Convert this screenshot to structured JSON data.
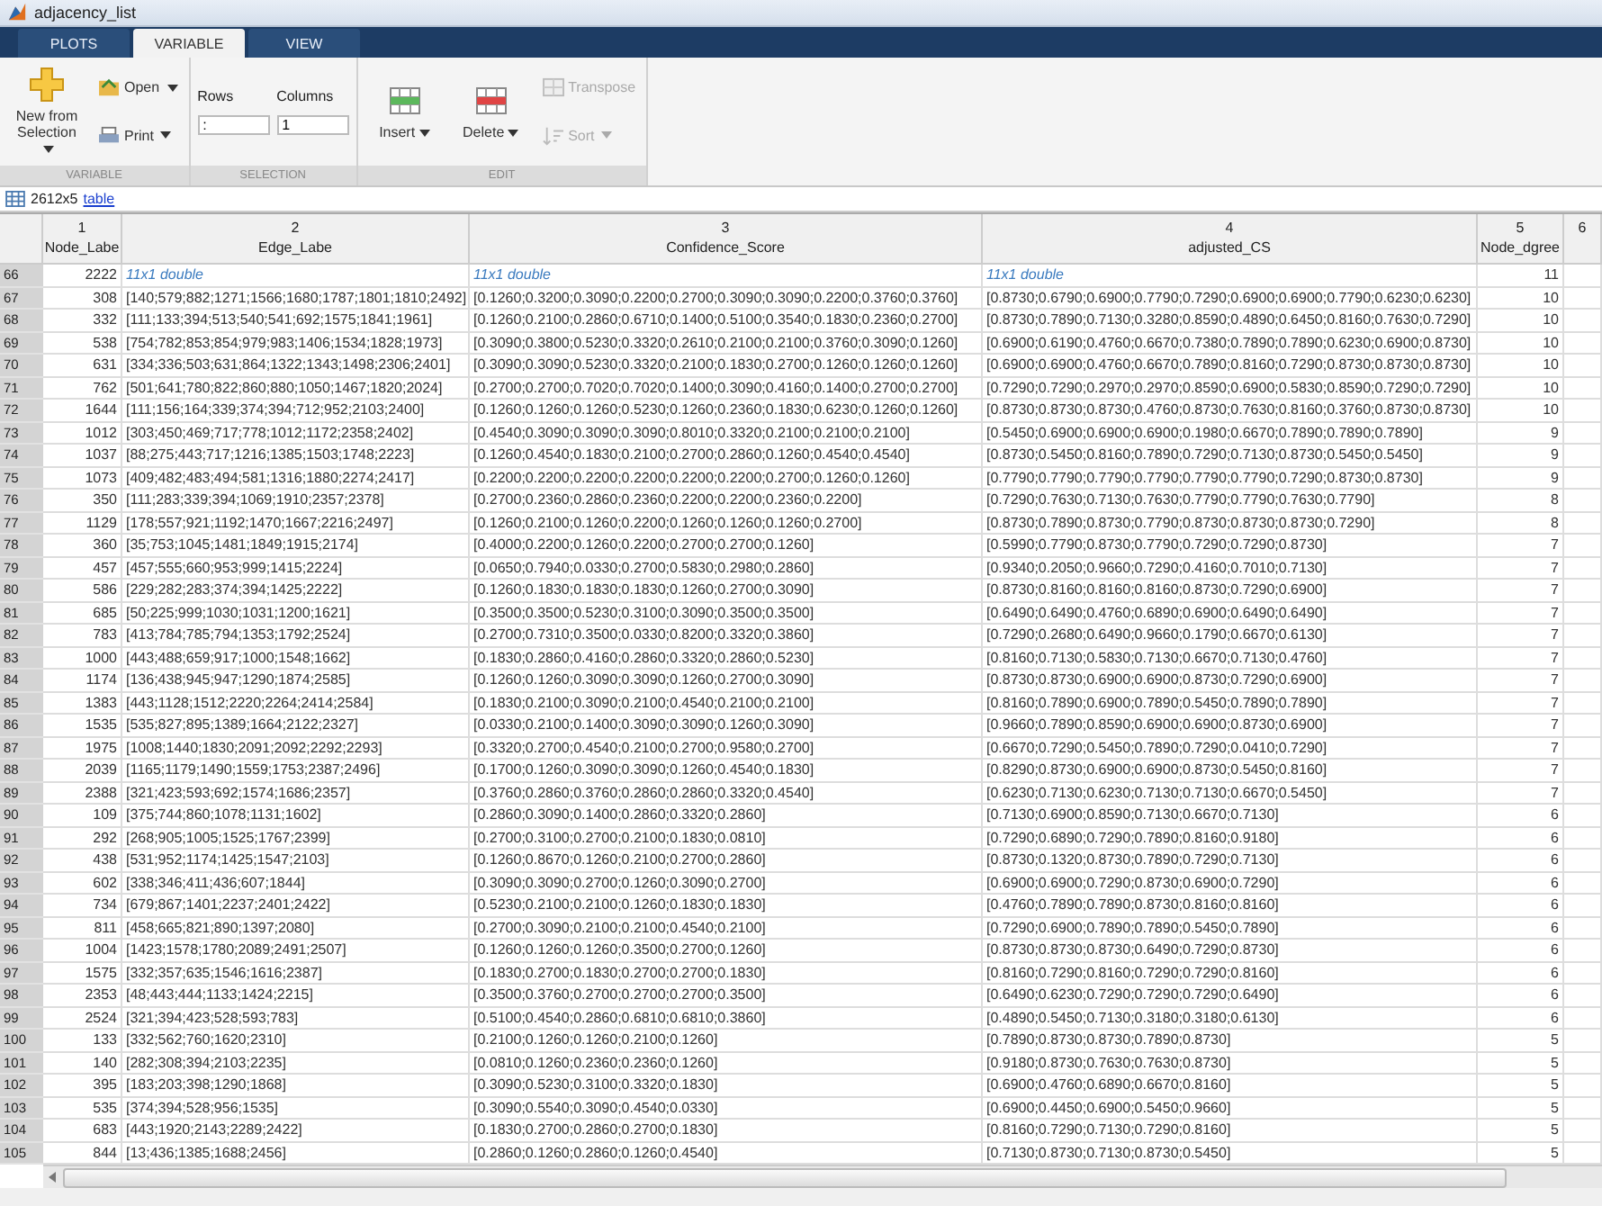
{
  "window": {
    "title": "adjacency_list"
  },
  "tabs": [
    {
      "label": "PLOTS",
      "selected": false
    },
    {
      "label": "VARIABLE",
      "selected": true
    },
    {
      "label": "VIEW",
      "selected": false
    }
  ],
  "ribbon": [
    {
      "label": "VARIABLE",
      "items": [
        {
          "kind": "large",
          "label": "New from Selection",
          "dropdown": true,
          "disabled": false
        },
        {
          "kind": "small",
          "label": "Open",
          "dropdown": true,
          "disabled": false
        },
        {
          "kind": "small",
          "label": "Print",
          "dropdown": true,
          "disabled": false
        }
      ]
    },
    {
      "label": "SELECTION",
      "items": [
        {
          "kind": "field",
          "label": "Rows",
          "value": ":"
        },
        {
          "kind": "field",
          "label": "Columns",
          "value": "1"
        }
      ]
    },
    {
      "label": "EDIT",
      "items": [
        {
          "kind": "large",
          "label": "Insert",
          "dropdown": true,
          "disabled": false
        },
        {
          "kind": "large",
          "label": "Delete",
          "dropdown": true,
          "disabled": false
        },
        {
          "kind": "small",
          "label": "Transpose",
          "dropdown": false,
          "disabled": true
        },
        {
          "kind": "small",
          "label": "Sort",
          "dropdown": true,
          "disabled": true
        }
      ]
    }
  ],
  "variable_info": {
    "size": "2612x5",
    "type_link": "table"
  },
  "table": {
    "columns": [
      {
        "index": "1",
        "name": "Node_Labe"
      },
      {
        "index": "2",
        "name": "Edge_Labe"
      },
      {
        "index": "3",
        "name": "Confidence_Score"
      },
      {
        "index": "4",
        "name": "adjusted_CS"
      },
      {
        "index": "5",
        "name": "Node_dgree"
      },
      {
        "index": "6"
      }
    ],
    "rows": [
      {
        "row": "66",
        "summary": true,
        "node_labe": "2222",
        "edge_labe": "11x1 double",
        "confidence_score": "11x1 double",
        "adjusted_cs": "11x1 double",
        "node_dgree": "11"
      },
      {
        "row": "67",
        "summary": false,
        "node_labe": "308",
        "edge_labe": "[140;579;882;1271;1566;1680;1787;1801;1810;2492]",
        "confidence_score": "[0.1260;0.3200;0.3090;0.2200;0.2700;0.3090;0.3090;0.2200;0.3760;0.3760]",
        "adjusted_cs": "[0.8730;0.6790;0.6900;0.7790;0.7290;0.6900;0.6900;0.7790;0.6230;0.6230]",
        "node_dgree": "10"
      },
      {
        "row": "68",
        "summary": false,
        "node_labe": "332",
        "edge_labe": "[111;133;394;513;540;541;692;1575;1841;1961]",
        "confidence_score": "[0.1260;0.2100;0.2860;0.6710;0.1400;0.5100;0.3540;0.1830;0.2360;0.2700]",
        "adjusted_cs": "[0.8730;0.7890;0.7130;0.3280;0.8590;0.4890;0.6450;0.8160;0.7630;0.7290]",
        "node_dgree": "10"
      },
      {
        "row": "69",
        "summary": false,
        "node_labe": "538",
        "edge_labe": "[754;782;853;854;979;983;1406;1534;1828;1973]",
        "confidence_score": "[0.3090;0.3800;0.5230;0.3320;0.2610;0.2100;0.2100;0.3760;0.3090;0.1260]",
        "adjusted_cs": "[0.6900;0.6190;0.4760;0.6670;0.7380;0.7890;0.7890;0.6230;0.6900;0.8730]",
        "node_dgree": "10"
      },
      {
        "row": "70",
        "summary": false,
        "node_labe": "631",
        "edge_labe": "[334;336;503;631;864;1322;1343;1498;2306;2401]",
        "confidence_score": "[0.3090;0.3090;0.5230;0.3320;0.2100;0.1830;0.2700;0.1260;0.1260;0.1260]",
        "adjusted_cs": "[0.6900;0.6900;0.4760;0.6670;0.7890;0.8160;0.7290;0.8730;0.8730;0.8730]",
        "node_dgree": "10"
      },
      {
        "row": "71",
        "summary": false,
        "node_labe": "762",
        "edge_labe": "[501;641;780;822;860;880;1050;1467;1820;2024]",
        "confidence_score": "[0.2700;0.2700;0.7020;0.7020;0.1400;0.3090;0.4160;0.1400;0.2700;0.2700]",
        "adjusted_cs": "[0.7290;0.7290;0.2970;0.2970;0.8590;0.6900;0.5830;0.8590;0.7290;0.7290]",
        "node_dgree": "10"
      },
      {
        "row": "72",
        "summary": false,
        "node_labe": "1644",
        "edge_labe": "[111;156;164;339;374;394;712;952;2103;2400]",
        "confidence_score": "[0.1260;0.1260;0.1260;0.5230;0.1260;0.2360;0.1830;0.6230;0.1260;0.1260]",
        "adjusted_cs": "[0.8730;0.8730;0.8730;0.4760;0.8730;0.7630;0.8160;0.3760;0.8730;0.8730]",
        "node_dgree": "10"
      },
      {
        "row": "73",
        "summary": false,
        "node_labe": "1012",
        "edge_labe": "[303;450;469;717;778;1012;1172;2358;2402]",
        "confidence_score": "[0.4540;0.3090;0.3090;0.3090;0.8010;0.3320;0.2100;0.2100;0.2100]",
        "adjusted_cs": "[0.5450;0.6900;0.6900;0.6900;0.1980;0.6670;0.7890;0.7890;0.7890]",
        "node_dgree": "9"
      },
      {
        "row": "74",
        "summary": false,
        "node_labe": "1037",
        "edge_labe": "[88;275;443;717;1216;1385;1503;1748;2223]",
        "confidence_score": "[0.1260;0.4540;0.1830;0.2100;0.2700;0.2860;0.1260;0.4540;0.4540]",
        "adjusted_cs": "[0.8730;0.5450;0.8160;0.7890;0.7290;0.7130;0.8730;0.5450;0.5450]",
        "node_dgree": "9"
      },
      {
        "row": "75",
        "summary": false,
        "node_labe": "1073",
        "edge_labe": "[409;482;483;494;581;1316;1880;2274;2417]",
        "confidence_score": "[0.2200;0.2200;0.2200;0.2200;0.2200;0.2200;0.2700;0.1260;0.1260]",
        "adjusted_cs": "[0.7790;0.7790;0.7790;0.7790;0.7790;0.7790;0.7290;0.8730;0.8730]",
        "node_dgree": "9"
      },
      {
        "row": "76",
        "summary": false,
        "node_labe": "350",
        "edge_labe": "[111;283;339;394;1069;1910;2357;2378]",
        "confidence_score": "[0.2700;0.2360;0.2860;0.2360;0.2200;0.2200;0.2360;0.2200]",
        "adjusted_cs": "[0.7290;0.7630;0.7130;0.7630;0.7790;0.7790;0.7630;0.7790]",
        "node_dgree": "8"
      },
      {
        "row": "77",
        "summary": false,
        "node_labe": "1129",
        "edge_labe": "[178;557;921;1192;1470;1667;2216;2497]",
        "confidence_score": "[0.1260;0.2100;0.1260;0.2200;0.1260;0.1260;0.1260;0.2700]",
        "adjusted_cs": "[0.8730;0.7890;0.8730;0.7790;0.8730;0.8730;0.8730;0.7290]",
        "node_dgree": "8"
      },
      {
        "row": "78",
        "summary": false,
        "node_labe": "360",
        "edge_labe": "[35;753;1045;1481;1849;1915;2174]",
        "confidence_score": "[0.4000;0.2200;0.1260;0.2200;0.2700;0.2700;0.1260]",
        "adjusted_cs": "[0.5990;0.7790;0.8730;0.7790;0.7290;0.7290;0.8730]",
        "node_dgree": "7"
      },
      {
        "row": "79",
        "summary": false,
        "node_labe": "457",
        "edge_labe": "[457;555;660;953;999;1415;2224]",
        "confidence_score": "[0.0650;0.7940;0.0330;0.2700;0.5830;0.2980;0.2860]",
        "adjusted_cs": "[0.9340;0.2050;0.9660;0.7290;0.4160;0.7010;0.7130]",
        "node_dgree": "7"
      },
      {
        "row": "80",
        "summary": false,
        "node_labe": "586",
        "edge_labe": "[229;282;283;374;394;1425;2222]",
        "confidence_score": "[0.1260;0.1830;0.1830;0.1830;0.1260;0.2700;0.3090]",
        "adjusted_cs": "[0.8730;0.8160;0.8160;0.8160;0.8730;0.7290;0.6900]",
        "node_dgree": "7"
      },
      {
        "row": "81",
        "summary": false,
        "node_labe": "685",
        "edge_labe": "[50;225;999;1030;1031;1200;1621]",
        "confidence_score": "[0.3500;0.3500;0.5230;0.3100;0.3090;0.3500;0.3500]",
        "adjusted_cs": "[0.6490;0.6490;0.4760;0.6890;0.6900;0.6490;0.6490]",
        "node_dgree": "7"
      },
      {
        "row": "82",
        "summary": false,
        "node_labe": "783",
        "edge_labe": "[413;784;785;794;1353;1792;2524]",
        "confidence_score": "[0.2700;0.7310;0.3500;0.0330;0.8200;0.3320;0.3860]",
        "adjusted_cs": "[0.7290;0.2680;0.6490;0.9660;0.1790;0.6670;0.6130]",
        "node_dgree": "7"
      },
      {
        "row": "83",
        "summary": false,
        "node_labe": "1000",
        "edge_labe": "[443;488;659;917;1000;1548;1662]",
        "confidence_score": "[0.1830;0.2860;0.4160;0.2860;0.3320;0.2860;0.5230]",
        "adjusted_cs": "[0.8160;0.7130;0.5830;0.7130;0.6670;0.7130;0.4760]",
        "node_dgree": "7"
      },
      {
        "row": "84",
        "summary": false,
        "node_labe": "1174",
        "edge_labe": "[136;438;945;947;1290;1874;2585]",
        "confidence_score": "[0.1260;0.1260;0.3090;0.3090;0.1260;0.2700;0.3090]",
        "adjusted_cs": "[0.8730;0.8730;0.6900;0.6900;0.8730;0.7290;0.6900]",
        "node_dgree": "7"
      },
      {
        "row": "85",
        "summary": false,
        "node_labe": "1383",
        "edge_labe": "[443;1128;1512;2220;2264;2414;2584]",
        "confidence_score": "[0.1830;0.2100;0.3090;0.2100;0.4540;0.2100;0.2100]",
        "adjusted_cs": "[0.8160;0.7890;0.6900;0.7890;0.5450;0.7890;0.7890]",
        "node_dgree": "7"
      },
      {
        "row": "86",
        "summary": false,
        "node_labe": "1535",
        "edge_labe": "[535;827;895;1389;1664;2122;2327]",
        "confidence_score": "[0.0330;0.2100;0.1400;0.3090;0.3090;0.1260;0.3090]",
        "adjusted_cs": "[0.9660;0.7890;0.8590;0.6900;0.6900;0.8730;0.6900]",
        "node_dgree": "7"
      },
      {
        "row": "87",
        "summary": false,
        "node_labe": "1975",
        "edge_labe": "[1008;1440;1830;2091;2092;2292;2293]",
        "confidence_score": "[0.3320;0.2700;0.4540;0.2100;0.2700;0.9580;0.2700]",
        "adjusted_cs": "[0.6670;0.7290;0.5450;0.7890;0.7290;0.0410;0.7290]",
        "node_dgree": "7"
      },
      {
        "row": "88",
        "summary": false,
        "node_labe": "2039",
        "edge_labe": "[1165;1179;1490;1559;1753;2387;2496]",
        "confidence_score": "[0.1700;0.1260;0.3090;0.3090;0.1260;0.4540;0.1830]",
        "adjusted_cs": "[0.8290;0.8730;0.6900;0.6900;0.8730;0.5450;0.8160]",
        "node_dgree": "7"
      },
      {
        "row": "89",
        "summary": false,
        "node_labe": "2388",
        "edge_labe": "[321;423;593;692;1574;1686;2357]",
        "confidence_score": "[0.3760;0.2860;0.3760;0.2860;0.2860;0.3320;0.4540]",
        "adjusted_cs": "[0.6230;0.7130;0.6230;0.7130;0.7130;0.6670;0.5450]",
        "node_dgree": "7"
      },
      {
        "row": "90",
        "summary": false,
        "node_labe": "109",
        "edge_labe": "[375;744;860;1078;1131;1602]",
        "confidence_score": "[0.2860;0.3090;0.1400;0.2860;0.3320;0.2860]",
        "adjusted_cs": "[0.7130;0.6900;0.8590;0.7130;0.6670;0.7130]",
        "node_dgree": "6"
      },
      {
        "row": "91",
        "summary": false,
        "node_labe": "292",
        "edge_labe": "[268;905;1005;1525;1767;2399]",
        "confidence_score": "[0.2700;0.3100;0.2700;0.2100;0.1830;0.0810]",
        "adjusted_cs": "[0.7290;0.6890;0.7290;0.7890;0.8160;0.9180]",
        "node_dgree": "6"
      },
      {
        "row": "92",
        "summary": false,
        "node_labe": "438",
        "edge_labe": "[531;952;1174;1425;1547;2103]",
        "confidence_score": "[0.1260;0.8670;0.1260;0.2100;0.2700;0.2860]",
        "adjusted_cs": "[0.8730;0.1320;0.8730;0.7890;0.7290;0.7130]",
        "node_dgree": "6"
      },
      {
        "row": "93",
        "summary": false,
        "node_labe": "602",
        "edge_labe": "[338;346;411;436;607;1844]",
        "confidence_score": "[0.3090;0.3090;0.2700;0.1260;0.3090;0.2700]",
        "adjusted_cs": "[0.6900;0.6900;0.7290;0.8730;0.6900;0.7290]",
        "node_dgree": "6"
      },
      {
        "row": "94",
        "summary": false,
        "node_labe": "734",
        "edge_labe": "[679;867;1401;2237;2401;2422]",
        "confidence_score": "[0.5230;0.2100;0.2100;0.1260;0.1830;0.1830]",
        "adjusted_cs": "[0.4760;0.7890;0.7890;0.8730;0.8160;0.8160]",
        "node_dgree": "6"
      },
      {
        "row": "95",
        "summary": false,
        "node_labe": "811",
        "edge_labe": "[458;665;821;890;1397;2080]",
        "confidence_score": "[0.2700;0.3090;0.2100;0.2100;0.4540;0.2100]",
        "adjusted_cs": "[0.7290;0.6900;0.7890;0.7890;0.5450;0.7890]",
        "node_dgree": "6"
      },
      {
        "row": "96",
        "summary": false,
        "node_labe": "1004",
        "edge_labe": "[1423;1578;1780;2089;2491;2507]",
        "confidence_score": "[0.1260;0.1260;0.1260;0.3500;0.2700;0.1260]",
        "adjusted_cs": "[0.8730;0.8730;0.8730;0.6490;0.7290;0.8730]",
        "node_dgree": "6"
      },
      {
        "row": "97",
        "summary": false,
        "node_labe": "1575",
        "edge_labe": "[332;357;635;1546;1616;2387]",
        "confidence_score": "[0.1830;0.2700;0.1830;0.2700;0.2700;0.1830]",
        "adjusted_cs": "[0.8160;0.7290;0.8160;0.7290;0.7290;0.8160]",
        "node_dgree": "6"
      },
      {
        "row": "98",
        "summary": false,
        "node_labe": "2353",
        "edge_labe": "[48;443;444;1133;1424;2215]",
        "confidence_score": "[0.3500;0.3760;0.2700;0.2700;0.2700;0.3500]",
        "adjusted_cs": "[0.6490;0.6230;0.7290;0.7290;0.7290;0.6490]",
        "node_dgree": "6"
      },
      {
        "row": "99",
        "summary": false,
        "node_labe": "2524",
        "edge_labe": "[321;394;423;528;593;783]",
        "confidence_score": "[0.5100;0.4540;0.2860;0.6810;0.6810;0.3860]",
        "adjusted_cs": "[0.4890;0.5450;0.7130;0.3180;0.3180;0.6130]",
        "node_dgree": "6"
      },
      {
        "row": "100",
        "summary": false,
        "node_labe": "133",
        "edge_labe": "[332;562;760;1620;2310]",
        "confidence_score": "[0.2100;0.1260;0.1260;0.2100;0.1260]",
        "adjusted_cs": "[0.7890;0.8730;0.8730;0.7890;0.8730]",
        "node_dgree": "5"
      },
      {
        "row": "101",
        "summary": false,
        "node_labe": "140",
        "edge_labe": "[282;308;394;2103;2235]",
        "confidence_score": "[0.0810;0.1260;0.2360;0.2360;0.1260]",
        "adjusted_cs": "[0.9180;0.8730;0.7630;0.7630;0.8730]",
        "node_dgree": "5"
      },
      {
        "row": "102",
        "summary": false,
        "node_labe": "395",
        "edge_labe": "[183;203;398;1290;1868]",
        "confidence_score": "[0.3090;0.5230;0.3100;0.3320;0.1830]",
        "adjusted_cs": "[0.6900;0.4760;0.6890;0.6670;0.8160]",
        "node_dgree": "5"
      },
      {
        "row": "103",
        "summary": false,
        "node_labe": "535",
        "edge_labe": "[374;394;528;956;1535]",
        "confidence_score": "[0.3090;0.5540;0.3090;0.4540;0.0330]",
        "adjusted_cs": "[0.6900;0.4450;0.6900;0.5450;0.9660]",
        "node_dgree": "5"
      },
      {
        "row": "104",
        "summary": false,
        "node_labe": "683",
        "edge_labe": "[443;1920;2143;2289;2422]",
        "confidence_score": "[0.1830;0.2700;0.2860;0.2700;0.1830]",
        "adjusted_cs": "[0.8160;0.7290;0.7130;0.7290;0.8160]",
        "node_dgree": "5"
      },
      {
        "row": "105",
        "summary": false,
        "node_labe": "844",
        "edge_labe": "[13;436;1385;1688;2456]",
        "confidence_score": "[0.2860;0.1260;0.2860;0.1260;0.4540]",
        "adjusted_cs": "[0.7130;0.8730;0.7130;0.8730;0.5450]",
        "node_dgree": "5"
      }
    ]
  }
}
